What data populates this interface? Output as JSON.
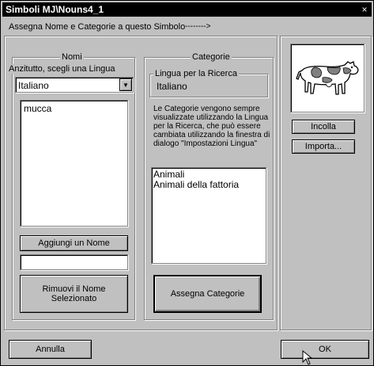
{
  "window": {
    "title": "Simboli MJ\\Nouns4_1",
    "close_label": "×"
  },
  "instruction": {
    "text": "Assegna Nome e Categorie a questo Simbolo",
    "arrow": "-------->"
  },
  "names": {
    "group_label": "Nomi",
    "language_prompt": "Anzitutto, scegli una Lingua",
    "language_selected": "Italiano",
    "items": [
      "mucca"
    ],
    "add_button": "Aggiungi un Nome",
    "new_name_value": "",
    "remove_button": "Rimuovi il Nome Selezionato"
  },
  "categories": {
    "group_label": "Categorie",
    "search_language_label": "Lingua per la Ricerca",
    "search_language_value": "Italiano",
    "info_text": "Le Categorie vengono sempre visualizzate utilizzando la Lingua per la Ricerca, che può essere cambiata utilizzando la finestra di dialogo \"Impostazioni Lingua\"",
    "items": [
      "Animali",
      "Animali della fattoria"
    ],
    "assign_button": "Assegna Categorie"
  },
  "symbol": {
    "image_icon": "cow-icon",
    "paste_button": "Incolla",
    "import_button": "Importa..."
  },
  "footer": {
    "cancel_button": "Annulla",
    "ok_button": "OK"
  }
}
